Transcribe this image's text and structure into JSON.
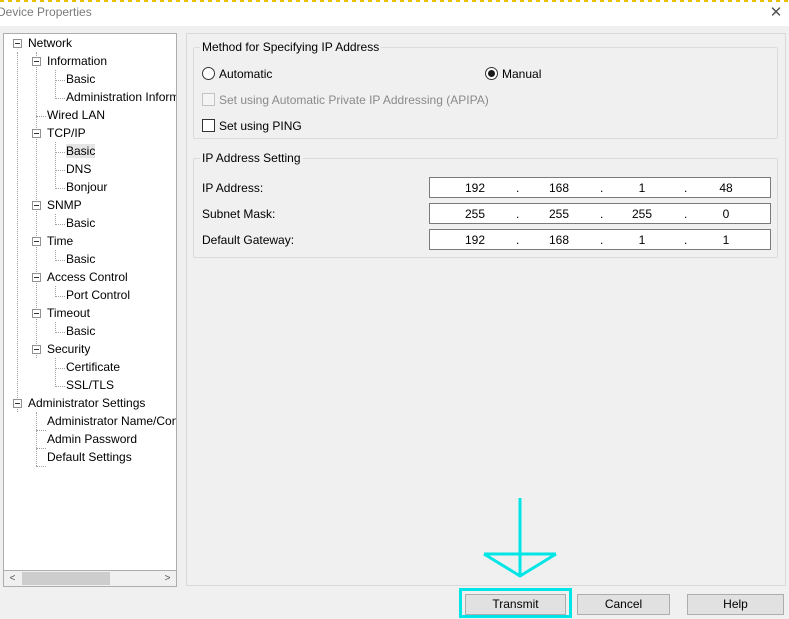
{
  "window": {
    "title": "Device Properties",
    "close_glyph": "✕"
  },
  "tree": {
    "items": [
      {
        "label": "Network"
      },
      {
        "label": "Information"
      },
      {
        "label": "Basic"
      },
      {
        "label": "Administration Information"
      },
      {
        "label": "Wired LAN"
      },
      {
        "label": "TCP/IP"
      },
      {
        "label": "Basic"
      },
      {
        "label": "DNS"
      },
      {
        "label": "Bonjour"
      },
      {
        "label": "SNMP"
      },
      {
        "label": "Basic"
      },
      {
        "label": "Time"
      },
      {
        "label": "Basic"
      },
      {
        "label": "Access Control"
      },
      {
        "label": "Port Control"
      },
      {
        "label": "Timeout"
      },
      {
        "label": "Basic"
      },
      {
        "label": "Security"
      },
      {
        "label": "Certificate"
      },
      {
        "label": "SSL/TLS"
      },
      {
        "label": "Administrator Settings"
      },
      {
        "label": "Administrator Name/Contact"
      },
      {
        "label": "Admin Password"
      },
      {
        "label": "Default Settings"
      }
    ],
    "selected_label": "Basic"
  },
  "method_group": {
    "title": "Method for Specifying IP Address",
    "automatic_label": "Automatic",
    "manual_label": "Manual",
    "selected": "Manual",
    "apipa_label": "Set using Automatic Private IP Addressing (APIPA)",
    "apipa_checked": false,
    "apipa_enabled": false,
    "ping_label": "Set using PING",
    "ping_checked": false
  },
  "ip_group": {
    "title": "IP Address Setting",
    "ip_address": {
      "label": "IP Address:",
      "octets": [
        "192",
        "168",
        "1",
        "48"
      ]
    },
    "subnet_mask": {
      "label": "Subnet Mask:",
      "octets": [
        "255",
        "255",
        "255",
        "0"
      ]
    },
    "default_gateway": {
      "label": "Default Gateway:",
      "octets": [
        "192",
        "168",
        "1",
        "1"
      ]
    },
    "separator": "."
  },
  "buttons": {
    "transmit": "Transmit",
    "cancel": "Cancel",
    "help": "Help"
  },
  "annotation": {
    "highlight_color": "#00e5e5",
    "target": "Transmit"
  },
  "scroll": {
    "left_glyph": "<",
    "right_glyph": ">"
  }
}
